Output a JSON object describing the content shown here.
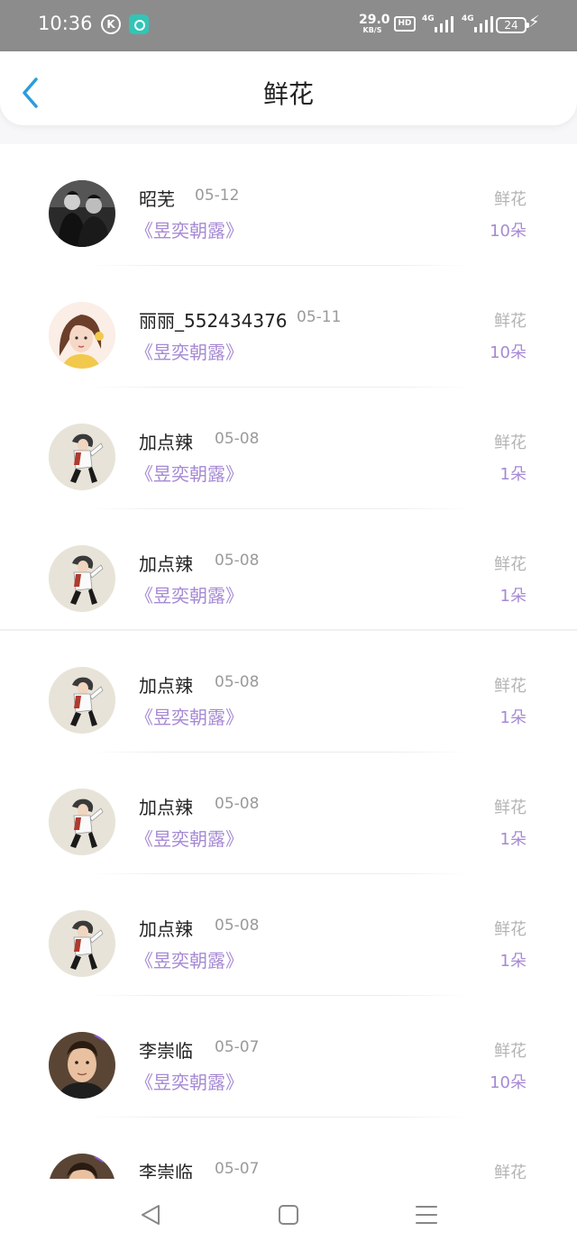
{
  "status_bar": {
    "time": "10:36",
    "k_badge": "K",
    "net_speed": "29.0",
    "net_unit": "KB/S",
    "hd_label": "HD",
    "signal1_label": "4G",
    "signal2_label": "4G",
    "battery": "24"
  },
  "header": {
    "title": "鲜花",
    "back_icon": "chevron-left-icon"
  },
  "items": [
    {
      "name": "昭芜",
      "date": "05-12",
      "work": "《昱奕朝露》",
      "gift": "鲜花",
      "count": "10朵",
      "avatar": "photo"
    },
    {
      "name": "丽丽_552434376",
      "date": "05-11",
      "work": "《昱奕朝露》",
      "gift": "鲜花",
      "count": "10朵",
      "avatar": "girl"
    },
    {
      "name": "加点辣",
      "date": "05-08",
      "work": "《昱奕朝露》",
      "gift": "鲜花",
      "count": "1朵",
      "avatar": "dancer"
    },
    {
      "name": "加点辣",
      "date": "05-08",
      "work": "《昱奕朝露》",
      "gift": "鲜花",
      "count": "1朵",
      "avatar": "dancer"
    },
    {
      "name": "加点辣",
      "date": "05-08",
      "work": "《昱奕朝露》",
      "gift": "鲜花",
      "count": "1朵",
      "avatar": "dancer"
    },
    {
      "name": "加点辣",
      "date": "05-08",
      "work": "《昱奕朝露》",
      "gift": "鲜花",
      "count": "1朵",
      "avatar": "dancer"
    },
    {
      "name": "加点辣",
      "date": "05-08",
      "work": "《昱奕朝露》",
      "gift": "鲜花",
      "count": "1朵",
      "avatar": "dancer"
    },
    {
      "name": "李崇临",
      "date": "05-07",
      "work": "《昱奕朝露》",
      "gift": "鲜花",
      "count": "10朵",
      "avatar": "man"
    },
    {
      "name": "李崇临",
      "date": "05-07",
      "work": "",
      "gift": "鲜花",
      "count": "",
      "avatar": "man"
    }
  ],
  "nav_bar": {
    "back": "back-triangle-icon",
    "home": "home-square-icon",
    "menu": "menu-lines-icon"
  },
  "colors": {
    "accent": "#a68ad4",
    "back_arrow": "#2d9cdb",
    "status_bg": "#8c8c8c"
  }
}
